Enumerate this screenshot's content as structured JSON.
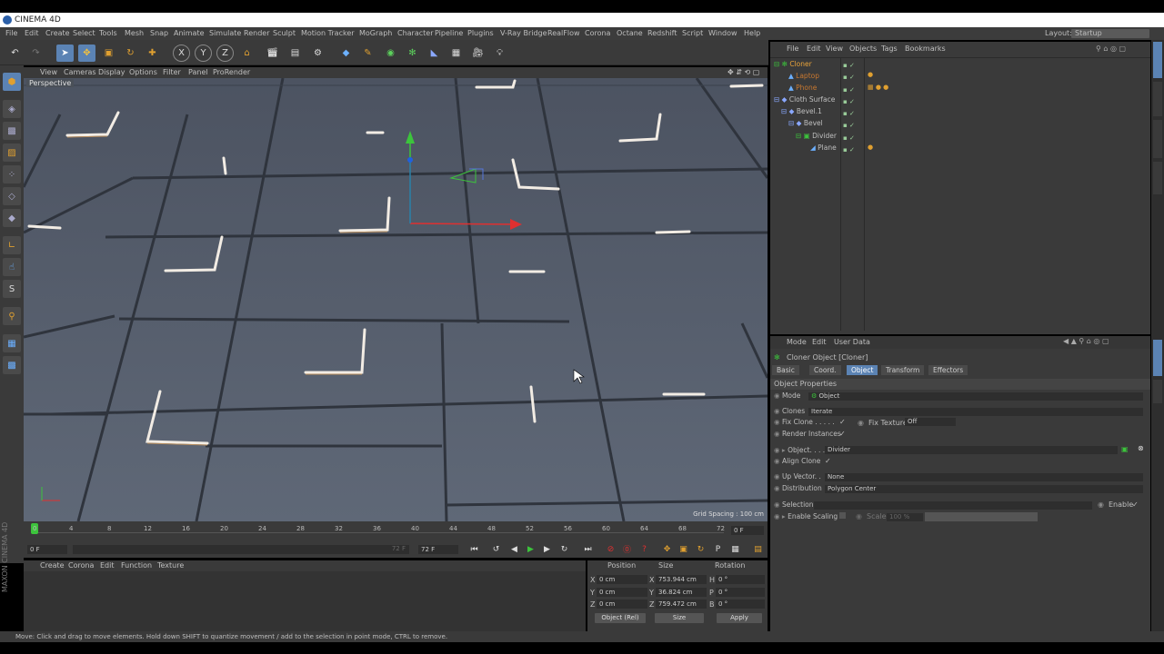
{
  "window": {
    "title": "CINEMA 4D"
  },
  "menu": [
    "File",
    "Edit",
    "Create",
    "Select",
    "Tools",
    "Mesh",
    "Snap",
    "Animate",
    "Simulate",
    "Render",
    "Sculpt",
    "Motion Tracker",
    "MoGraph",
    "Character",
    "Pipeline",
    "Plugins",
    "V-Ray Bridge",
    "RealFlow",
    "Corona",
    "Octane",
    "Redshift",
    "Script",
    "Window",
    "Help"
  ],
  "layout": {
    "label": "Layout:",
    "value": "Startup"
  },
  "viewport": {
    "menu": [
      "View",
      "Cameras",
      "Display",
      "Options",
      "Filter",
      "Panel",
      "ProRender"
    ],
    "label": "Perspective",
    "grid_spacing": "Grid Spacing : 100 cm"
  },
  "timeline": {
    "ticks": [
      "0",
      "4",
      "8",
      "12",
      "16",
      "20",
      "24",
      "28",
      "32",
      "36",
      "40",
      "44",
      "48",
      "52",
      "56",
      "60",
      "64",
      "68",
      "72"
    ],
    "current_frame": "0 F",
    "start": "0 F",
    "end": "72 F",
    "range_end": "72 F",
    "frame_label": "0 F"
  },
  "materials": {
    "menu": [
      "Create",
      "Corona",
      "Edit",
      "Function",
      "Texture"
    ]
  },
  "coords": {
    "headers": [
      "Position",
      "Size",
      "Rotation"
    ],
    "rows": [
      {
        "axis": "X",
        "pos": "0 cm",
        "saxis": "X",
        "size": "753.944 cm",
        "raxis": "H",
        "rot": "0 °"
      },
      {
        "axis": "Y",
        "pos": "0 cm",
        "saxis": "Y",
        "size": "36.824 cm",
        "raxis": "P",
        "rot": "0 °"
      },
      {
        "axis": "Z",
        "pos": "0 cm",
        "saxis": "Z",
        "size": "759.472 cm",
        "raxis": "B",
        "rot": "0 °"
      }
    ],
    "mode": "Object (Rel)",
    "size_mode": "Size",
    "apply": "Apply"
  },
  "status": "Move: Click and drag to move elements. Hold down SHIFT to quantize movement / add to the selection in point mode, CTRL to remove.",
  "objects": {
    "menu": [
      "File",
      "Edit",
      "View",
      "Objects",
      "Tags",
      "Bookmarks"
    ],
    "items": [
      {
        "name": "Cloner",
        "color": "#e8a33a"
      },
      {
        "name": "Laptop",
        "color": "#c87830"
      },
      {
        "name": "Phone",
        "color": "#c87830"
      },
      {
        "name": "Cloth Surface",
        "color": "#cfcfcf"
      },
      {
        "name": "Bevel.1",
        "color": "#cfcfcf"
      },
      {
        "name": "Bevel",
        "color": "#cfcfcf"
      },
      {
        "name": "Divider",
        "color": "#cfcfcf"
      },
      {
        "name": "Plane",
        "color": "#cfcfcf"
      }
    ]
  },
  "attributes": {
    "menu": [
      "Mode",
      "Edit",
      "User Data"
    ],
    "title": "Cloner Object [Cloner]",
    "tabs": [
      "Basic",
      "Coord.",
      "Object",
      "Transform",
      "Effectors"
    ],
    "active_tab": "Object",
    "section": "Object Properties",
    "mode_label": "Mode",
    "mode_value": "Object",
    "clones_label": "Clones",
    "clones_value": "Iterate",
    "fix_clone": "Fix Clone . . . . .",
    "fix_texture": "Fix Texture",
    "fix_texture_value": "Off",
    "render_instances": "Render Instances",
    "object_label": "Object. . . . .",
    "object_value": "Divider",
    "align_clone": "Align Clone",
    "up_vector": "Up Vector. .",
    "up_vector_value": "None",
    "distribution": "Distribution",
    "distribution_value": "Polygon Center",
    "selection": "Selection",
    "enable": "Enable",
    "enable_scaling": "Enable Scaling",
    "scale": "Scale",
    "scale_value": "100 %",
    "checkmark": "✓"
  },
  "brand": "MAXON CINEMA 4D",
  "colors": {
    "accent": "#5b83b4",
    "panel": "#3a3a3a",
    "viewport": "#5a6270"
  }
}
